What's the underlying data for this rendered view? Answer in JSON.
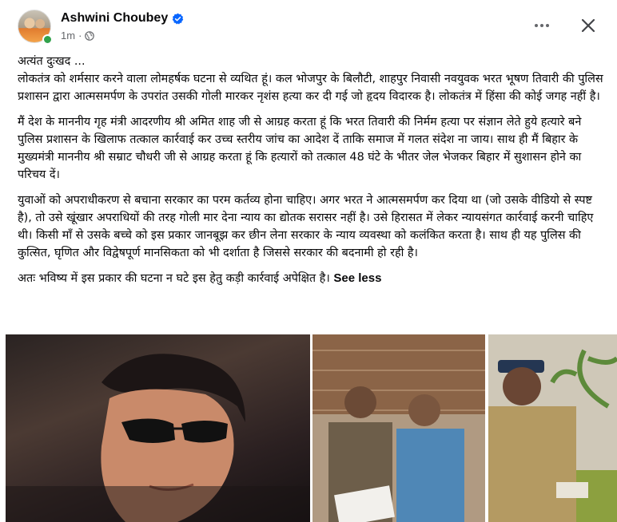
{
  "post": {
    "author": "Ashwini Choubey",
    "time": "1m",
    "paragraphs": [
      "अत्यंत दुःखद ...\nलोकतंत्र को शर्मसार करने वाला लोमहर्षक घटना से व्यथित हूं। कल भोजपुर के बिलौटी, शाहपुर निवासी नवयुवक भरत भूषण तिवारी की पुलिस प्रशासन द्वारा आत्मसमर्पण के उपरांत उसकी गोली मारकर नृशंस हत्या कर दी गई जो हृदय विदारक है। लोकतंत्र में हिंसा की कोई जगह नहीं है।",
      "मैं देश के माननीय गृह मंत्री आदरणीय श्री अमित शाह जी से आग्रह करता हूं कि भरत तिवारी की निर्मम हत्या पर संज्ञान लेते हुये हत्यारे बने पुलिस प्रशासन के खिलाफ तत्काल कार्रवाई कर उच्च स्तरीय जांच का आदेश दें ताकि समाज में गलत संदेश ना जाय। साथ ही मैं बिहार के मुख्यमंत्री माननीय श्री सम्राट चौधरी जी से आग्रह करता हूं कि हत्यारों को तत्काल 48 घंटे के भीतर जेल भेजकर बिहार में सुशासन होने का परिचय दें।",
      "युवाओं को अपराधीकरण से बचाना सरकार का परम कर्तव्य होना चाहिए। अगर भरत ने आत्मसमर्पण कर दिया था (जो उसके वीडियो से स्पष्ट है), तो उसे खूंखार अपराधियों की तरह गोली मार देना न्याय का द्योतक सरासर नहीं है। उसे हिरासत में लेकर न्यायसंगत कार्रवाई करनी चाहिए थी। किसी माँ से उसके बच्चे को इस प्रकार जानबूझ कर छीन लेना सरकार के न्याय व्यवस्था को कलंकित करता है। साथ ही यह पुलिस की कुत्सित, घृणित और विद्वेषपूर्ण मानसिकता को भी दर्शाता है जिससे सरकार की बदनामी हो रही है।",
      "अतः भविष्य में इस प्रकार की घटना न घटे इस हेतु कड़ी कार्रवाई अपेक्षित है।"
    ],
    "see_less": "See less"
  },
  "icons": {
    "verified": "verified-badge-icon",
    "globe": "globe-icon",
    "more": "more-options-icon",
    "close": "close-icon"
  },
  "colors": {
    "text": "#080809",
    "meta": "#65676b",
    "verified": "#0866ff",
    "online": "#31a24c"
  }
}
